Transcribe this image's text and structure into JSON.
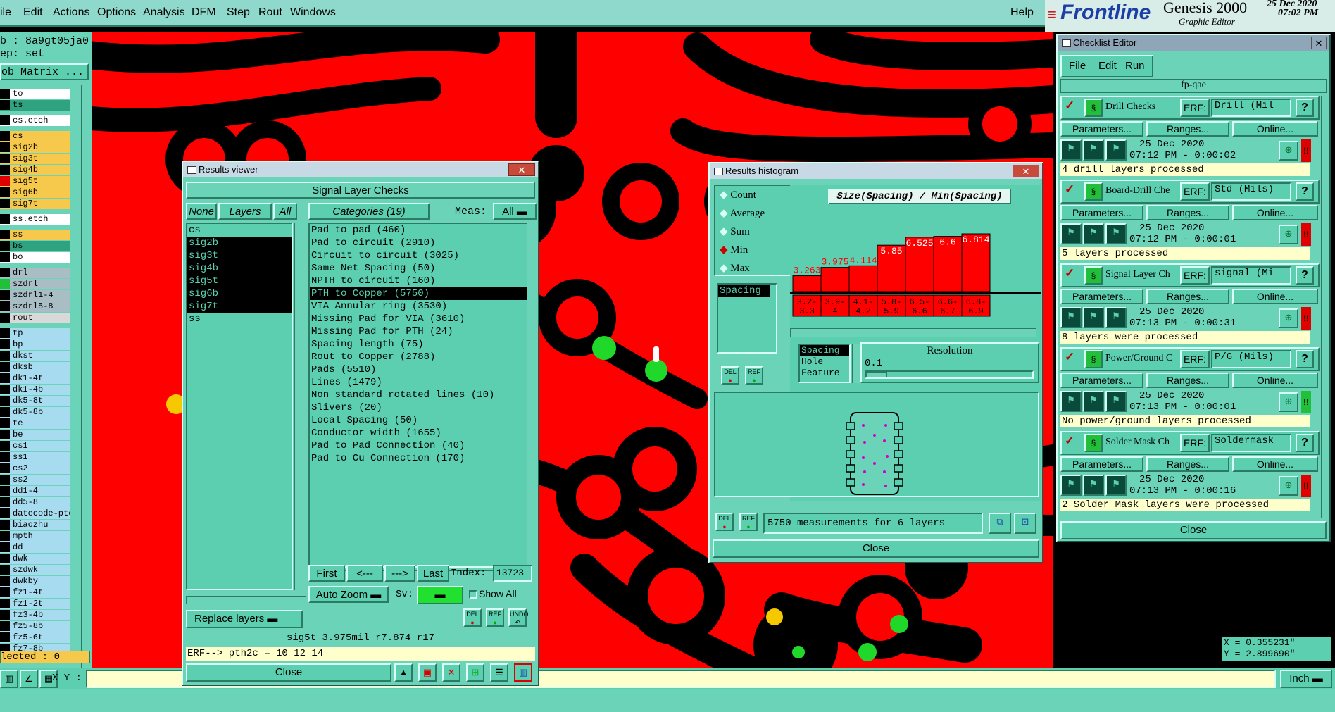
{
  "menubar": {
    "items": [
      "ile",
      "Edit",
      "Actions",
      "Options",
      "Analysis",
      "DFM",
      "Step",
      "Rout",
      "Windows"
    ],
    "help": "Help"
  },
  "brand": {
    "logo": "Frontline",
    "product": "Genesis 2000",
    "sub": "Graphic Editor",
    "date": "25 Dec 2020",
    "time": "07:02 PM"
  },
  "left_panel": {
    "job": "b : 8a9gt05ja0",
    "step": "ep: set",
    "matrix": "ob Matrix ...",
    "selected": "lected : 0",
    "layers": [
      {
        "n": "to",
        "c": "#ffffff"
      },
      {
        "n": "ts",
        "c": "#2fa27f"
      },
      {
        "n": "cs.etch",
        "c": "#ffffff"
      },
      {
        "n": "cs",
        "c": "#f6c84c"
      },
      {
        "n": "sig2b",
        "c": "#f6c84c"
      },
      {
        "n": "sig3t",
        "c": "#f6c84c"
      },
      {
        "n": "sig4b",
        "c": "#f6c84c"
      },
      {
        "n": "sig5t",
        "c": "#f6c84c",
        "sel": "#e00000"
      },
      {
        "n": "sig6b",
        "c": "#f6c84c"
      },
      {
        "n": "sig7t",
        "c": "#f6c84c"
      },
      {
        "n": "ss.etch",
        "c": "#ffffff"
      },
      {
        "n": "ss",
        "c": "#f6c84c"
      },
      {
        "n": "bs",
        "c": "#2fa27f"
      },
      {
        "n": "bo",
        "c": "#ffffff"
      },
      {
        "n": "drl",
        "c": "#a9bec4"
      },
      {
        "n": "szdrl",
        "c": "#a9bec4",
        "sel": "#22c03a"
      },
      {
        "n": "szdrl1-4",
        "c": "#a9bec4"
      },
      {
        "n": "szdrl5-8",
        "c": "#a9bec4"
      },
      {
        "n": "rout",
        "c": "#d9d9d9"
      },
      {
        "n": "tp",
        "c": "#a7dcf0"
      },
      {
        "n": "bp",
        "c": "#a7dcf0"
      },
      {
        "n": "dkst",
        "c": "#a7dcf0"
      },
      {
        "n": "dksb",
        "c": "#a7dcf0"
      },
      {
        "n": "dk1-4t",
        "c": "#a7dcf0"
      },
      {
        "n": "dk1-4b",
        "c": "#a7dcf0"
      },
      {
        "n": "dk5-8t",
        "c": "#a7dcf0"
      },
      {
        "n": "dk5-8b",
        "c": "#a7dcf0"
      },
      {
        "n": "te",
        "c": "#a7dcf0"
      },
      {
        "n": "be",
        "c": "#a7dcf0"
      },
      {
        "n": "cs1",
        "c": "#a7dcf0"
      },
      {
        "n": "ss1",
        "c": "#a7dcf0"
      },
      {
        "n": "cs2",
        "c": "#a7dcf0"
      },
      {
        "n": "ss2",
        "c": "#a7dcf0"
      },
      {
        "n": "dd1-4",
        "c": "#a7dcf0"
      },
      {
        "n": "dd5-8",
        "c": "#a7dcf0"
      },
      {
        "n": "datecode-ptc",
        "c": "#a7dcf0"
      },
      {
        "n": "biaozhu",
        "c": "#a7dcf0"
      },
      {
        "n": "mpth",
        "c": "#a7dcf0"
      },
      {
        "n": "dd",
        "c": "#a7dcf0"
      },
      {
        "n": "dwk",
        "c": "#a7dcf0"
      },
      {
        "n": "szdwk",
        "c": "#a7dcf0"
      },
      {
        "n": "dwkby",
        "c": "#a7dcf0"
      },
      {
        "n": "fz1-4t",
        "c": "#a7dcf0"
      },
      {
        "n": "fz1-2t",
        "c": "#a7dcf0"
      },
      {
        "n": "fz3-4b",
        "c": "#a7dcf0"
      },
      {
        "n": "fz5-8b",
        "c": "#a7dcf0"
      },
      {
        "n": "fz5-6t",
        "c": "#a7dcf0"
      },
      {
        "n": "fz7-8b",
        "c": "#a7dcf0"
      }
    ]
  },
  "statusbar": {
    "xy_label": "X Y :",
    "xy_value": "",
    "units": "Inch"
  },
  "coords": {
    "x": "X = 0.355231\"",
    "y": "Y = 2.899690\""
  },
  "results_viewer": {
    "title": "Results viewer",
    "header": "Signal Layer Checks",
    "none": "None",
    "layers_btn": "Layers",
    "all": "All",
    "categories": "Categories (19)",
    "meas": "Meas:",
    "meas_val": "All",
    "layers": [
      {
        "n": "cs"
      },
      {
        "n": "sig2b",
        "s": true
      },
      {
        "n": "sig3t",
        "s": true
      },
      {
        "n": "sig4b",
        "s": true
      },
      {
        "n": "sig5t",
        "s": true
      },
      {
        "n": "sig6b",
        "s": true
      },
      {
        "n": "sig7t",
        "s": true
      },
      {
        "n": "ss"
      }
    ],
    "categories_list": [
      {
        "t": "Pad to pad (460)"
      },
      {
        "t": "Pad to circuit (2910)"
      },
      {
        "t": "Circuit to circuit (3025)"
      },
      {
        "t": "Same Net Spacing (50)"
      },
      {
        "t": "NPTH to circuit (160)"
      },
      {
        "t": "PTH to Copper (5750)",
        "s": true
      },
      {
        "t": "VIA Annular ring (3530)"
      },
      {
        "t": "Missing Pad for VIA (3610)"
      },
      {
        "t": "Missing Pad for PTH (24)"
      },
      {
        "t": "Spacing length (75)"
      },
      {
        "t": "Rout to Copper (2788)"
      },
      {
        "t": "Pads (5510)"
      },
      {
        "t": "Lines (1479)"
      },
      {
        "t": "Non standard rotated lines (10)"
      },
      {
        "t": "Slivers (20)"
      },
      {
        "t": "Local Spacing (50)"
      },
      {
        "t": "Conductor width (1655)"
      },
      {
        "t": "Pad to Pad Connection (40)"
      },
      {
        "t": "Pad to Cu Connection (170)"
      }
    ],
    "first": "First",
    "prev": "<---",
    "next": "--->",
    "last": "Last",
    "index_label": "Index:",
    "index": "13723",
    "autozoom": "Auto Zoom",
    "sv": "Sv:",
    "showall": "Show All",
    "replace": "Replace layers",
    "del": "DEL",
    "ref": "REF",
    "undo": "UNDO",
    "info": "sig5t 3.975mil  r7.874  r17",
    "erf": "ERF--> pth2c = 10 12 14",
    "close": "Close"
  },
  "histogram": {
    "title": "Results histogram",
    "opts": [
      {
        "t": "Count",
        "on": false
      },
      {
        "t": "Average",
        "on": false
      },
      {
        "t": "Sum",
        "on": false
      },
      {
        "t": "Min",
        "on": true
      },
      {
        "t": "Max",
        "on": false
      }
    ],
    "list": [
      "Spacing"
    ],
    "chart_title": "Size(Spacing) / Min(Spacing)",
    "types": [
      "Spacing",
      "Hole",
      "Feature"
    ],
    "resolution": "Resolution",
    "res_val": "0.1",
    "del": "DEL",
    "ref": "REF",
    "status": "5750 measurements for 6 layers",
    "close": "Close"
  },
  "chart_data": {
    "type": "bar",
    "title": "Size(Spacing) / Min(Spacing)",
    "categories": [
      "3.2-3.3",
      "3.9-4",
      "4.1-4.2",
      "5.8-5.9",
      "6.5-6.6",
      "6.6-6.7",
      "6.8-6.9"
    ],
    "values": [
      3.263,
      3.975,
      4.114,
      5.85,
      6.525,
      6.6,
      6.814
    ],
    "value_labels": [
      "3.263",
      "3.975",
      "4.114",
      "5.85",
      "6.525",
      "6.6",
      "6.814"
    ],
    "cat_lines": [
      [
        "3.2-",
        "3.3"
      ],
      [
        "3.9-",
        "4"
      ],
      [
        "4.1-",
        "4.2"
      ],
      [
        "5.8-",
        "5.9"
      ],
      [
        "6.5-",
        "6.6"
      ],
      [
        "6.6-",
        "6.7"
      ],
      [
        "6.8-",
        "6.9"
      ]
    ],
    "colors": {
      "bar": "#ff0000",
      "label_red": "#ff0000",
      "label_white": "#ffffff"
    }
  },
  "checklist": {
    "title": "Checklist Editor",
    "menu": [
      "File",
      "Edit",
      "Run"
    ],
    "name": "fp-qae",
    "erf": "ERF:",
    "params": "Parameters...",
    "ranges": "Ranges...",
    "online": "Online...",
    "close": "Close",
    "checks": [
      {
        "name": "Drill Checks",
        "erf": "Drill (Mil",
        "date": "25 Dec 2020",
        "time": "07:12 PM - 0:00:02",
        "msg": "4 drill layers processed",
        "status": "#e00000"
      },
      {
        "name": "Board-Drill Che",
        "erf": "Std (Mils)",
        "date": "25 Dec 2020",
        "time": "07:12 PM - 0:00:01",
        "msg": "5 layers processed",
        "status": "#e00000"
      },
      {
        "name": "Signal Layer Ch",
        "erf": "signal (Mi",
        "date": "25 Dec 2020",
        "time": "07:13 PM - 0:00:31",
        "msg": "8 layers were processed",
        "status": "#e00000"
      },
      {
        "name": "Power/Ground C",
        "erf": "P/G (Mils)",
        "date": "25 Dec 2020",
        "time": "07:13 PM - 0:00:01",
        "msg": "No power/ground layers processed",
        "status": "#22c03a"
      },
      {
        "name": "Solder Mask Ch",
        "erf": "Soldermask",
        "date": "25 Dec 2020",
        "time": "07:13 PM - 0:00:16",
        "msg": "2 Solder Mask layers were processed",
        "status": "#e00000"
      }
    ]
  }
}
